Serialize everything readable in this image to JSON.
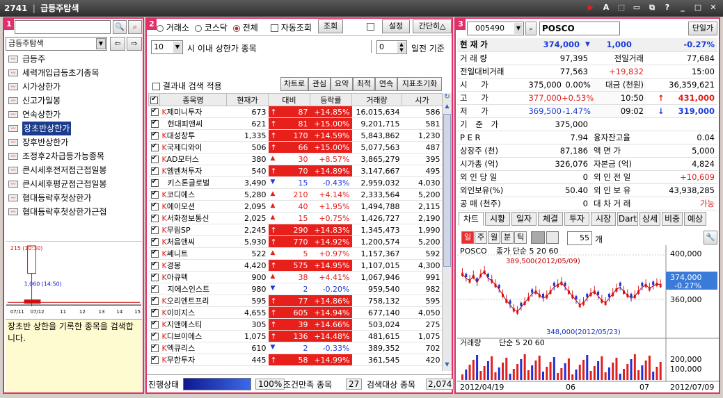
{
  "window": {
    "code": "2741",
    "title": "급등주탐색"
  },
  "left": {
    "panel_no": "1",
    "search_value": "",
    "category": "급등주탐색",
    "items": [
      "급등주",
      "세력개입급등초기종목",
      "시가상한가",
      "신고가일봉",
      "연속상한가",
      "장초반상한가",
      "장후반상한가",
      "조정후2차급등가능종목",
      "큰시세후전저점근접일봉",
      "큰시세후평균점근접일봉",
      "협대등락후첫상한가",
      "협대등락후첫상한가근접"
    ],
    "selected_index": 5,
    "chart": {
      "top_label": "215 (10:30)",
      "low_label": "1,060 (14:50)",
      "x_ticks": [
        "07/11",
        "07/12",
        "11",
        "12",
        "13",
        "14",
        "15"
      ]
    },
    "description": "장초반 상한을 기록한 종목을 검색합니다."
  },
  "mid": {
    "panel_no": "2",
    "market_options": [
      "거래소",
      "코스닥",
      "전체"
    ],
    "market_selected": "전체",
    "auto_label": "자동조회",
    "query_btn": "조회",
    "setting_btn": "설정",
    "simple_btn": "간단히△",
    "minutes": "10",
    "minutes_label": "시 이내 상한가 종목",
    "days": "0",
    "days_label": "일전 기준",
    "within_label": "결과내 검색 적용",
    "action_btns": [
      "차트로",
      "관심",
      "요약",
      "최적",
      "연속",
      "지표초기화"
    ],
    "columns": [
      "종목명",
      "현재가",
      "대비",
      "등락률",
      "거래량",
      "시가"
    ],
    "rows": [
      {
        "k": true,
        "name": "제미니투자",
        "price": "673",
        "dir": "up",
        "diff": "87",
        "rate": "+14.85%",
        "hl": true,
        "vol": "16,015,634",
        "open": "586"
      },
      {
        "k": false,
        "name": "현대피앤씨",
        "price": "621",
        "dir": "up",
        "diff": "81",
        "rate": "+15.00%",
        "hl": true,
        "vol": "9,201,715",
        "open": "581"
      },
      {
        "k": true,
        "name": "대성창투",
        "price": "1,335",
        "dir": "up",
        "diff": "170",
        "rate": "+14.59%",
        "hl": true,
        "vol": "5,843,862",
        "open": "1,230"
      },
      {
        "k": true,
        "name": "국제디와이",
        "price": "506",
        "dir": "up",
        "diff": "66",
        "rate": "+15.00%",
        "hl": true,
        "vol": "5,077,563",
        "open": "487"
      },
      {
        "k": true,
        "name": "AD모터스",
        "price": "380",
        "dir": "tri",
        "diff": "30",
        "rate": "+8.57%",
        "hl": false,
        "vol": "3,865,279",
        "open": "395"
      },
      {
        "k": true,
        "name": "엠벤처투자",
        "price": "540",
        "dir": "up",
        "diff": "70",
        "rate": "+14.89%",
        "hl": true,
        "vol": "3,147,667",
        "open": "495"
      },
      {
        "k": false,
        "name": "키스톤글로벌",
        "price": "3,490",
        "dir": "down",
        "diff": "15",
        "rate": "-0.43%",
        "hl": false,
        "vol": "2,959,032",
        "open": "4,030"
      },
      {
        "k": true,
        "name": "코디에스",
        "price": "5,280",
        "dir": "tri",
        "diff": "210",
        "rate": "+4.14%",
        "hl": false,
        "vol": "2,333,564",
        "open": "5,200"
      },
      {
        "k": true,
        "name": "에이모션",
        "price": "2,095",
        "dir": "tri",
        "diff": "40",
        "rate": "+1.95%",
        "hl": false,
        "vol": "1,494,788",
        "open": "2,115"
      },
      {
        "k": true,
        "name": "서화정보통신",
        "price": "2,025",
        "dir": "tri",
        "diff": "15",
        "rate": "+0.75%",
        "hl": false,
        "vol": "1,426,727",
        "open": "2,190"
      },
      {
        "k": true,
        "name": "무림SP",
        "price": "2,245",
        "dir": "up",
        "diff": "290",
        "rate": "+14.83%",
        "hl": true,
        "vol": "1,345,473",
        "open": "1,990"
      },
      {
        "k": true,
        "name": "처음앤씨",
        "price": "5,930",
        "dir": "up",
        "diff": "770",
        "rate": "+14.92%",
        "hl": true,
        "vol": "1,200,574",
        "open": "5,200"
      },
      {
        "k": true,
        "name": "쎄니트",
        "price": "522",
        "dir": "tri",
        "diff": "5",
        "rate": "+0.97%",
        "hl": false,
        "vol": "1,157,367",
        "open": "592"
      },
      {
        "k": true,
        "name": "경봉",
        "price": "4,420",
        "dir": "up",
        "diff": "575",
        "rate": "+14.95%",
        "hl": true,
        "vol": "1,107,015",
        "open": "4,300"
      },
      {
        "k": true,
        "name": "아큐텍",
        "price": "900",
        "dir": "tri",
        "diff": "38",
        "rate": "+4.41%",
        "hl": false,
        "vol": "1,067,946",
        "open": "991"
      },
      {
        "k": false,
        "name": "지에스인스트",
        "price": "980",
        "dir": "down",
        "diff": "2",
        "rate": "-0.20%",
        "hl": false,
        "vol": "959,540",
        "open": "982"
      },
      {
        "k": true,
        "name": "오리엔트프리",
        "price": "595",
        "dir": "up",
        "diff": "77",
        "rate": "+14.86%",
        "hl": true,
        "vol": "758,132",
        "open": "595"
      },
      {
        "k": true,
        "name": "이미지스",
        "price": "4,655",
        "dir": "up",
        "diff": "605",
        "rate": "+14.94%",
        "hl": true,
        "vol": "677,140",
        "open": "4,050"
      },
      {
        "k": true,
        "name": "지앤에스티",
        "price": "305",
        "dir": "up",
        "diff": "39",
        "rate": "+14.66%",
        "hl": true,
        "vol": "503,024",
        "open": "275"
      },
      {
        "k": true,
        "name": "디브이에스",
        "price": "1,075",
        "dir": "up",
        "diff": "136",
        "rate": "+14.48%",
        "hl": true,
        "vol": "481,615",
        "open": "1,075"
      },
      {
        "k": true,
        "name": "엑큐리스",
        "price": "610",
        "dir": "down",
        "diff": "2",
        "rate": "-0.33%",
        "hl": false,
        "vol": "389,352",
        "open": "702"
      },
      {
        "k": true,
        "name": "무한투자",
        "price": "445",
        "dir": "up",
        "diff": "58",
        "rate": "+14.99%",
        "hl": true,
        "vol": "361,545",
        "open": "420"
      }
    ],
    "status_label": "진행상태",
    "progress": "100%",
    "cond_label": "조건만족 종목",
    "cond_count": "27",
    "target_label": "검색대상 종목",
    "target_count": "2,074"
  },
  "right": {
    "panel_no": "3",
    "code": "005490",
    "name": "POSCO",
    "single_btn": "단일가",
    "cur_label": "현 재 가",
    "cur_price": "374,000",
    "cur_diff": "1,000",
    "cur_rate": "-0.27%",
    "rows": [
      [
        "거 래 량",
        "97,395",
        "전일거래",
        "77,684"
      ],
      [
        "전일대비거래",
        "77,563",
        "+19,832",
        "15:00"
      ]
    ],
    "ohlc": [
      {
        "lbl": "시 가",
        "v": "375,000",
        "p": "0.00%",
        "k": "대금 (천원)",
        "kv": "36,359,621"
      },
      {
        "lbl": "고 가",
        "v": "377,000",
        "p": "+0.53%",
        "k": "10:50",
        "kv": "431,000"
      },
      {
        "lbl": "저 가",
        "v": "369,500",
        "p": "-1.47%",
        "k": "09:02",
        "kv": "319,000"
      }
    ],
    "base_label": "기 준 가",
    "base_value": "375,000",
    "stats": [
      [
        "P E R",
        "7.94",
        "융자잔고율",
        "0.04"
      ],
      [
        "상장주 (천)",
        "87,186",
        "액 면 가",
        "5,000"
      ],
      [
        "시가총 (억)",
        "326,076",
        "자본금 (억)",
        "4,824"
      ],
      [
        "외 인 당 일",
        "0",
        "외 인 전 일",
        "+10,609"
      ],
      [
        "외인보유(%)",
        "50.40",
        "외 인 보 유",
        "43,938,285"
      ],
      [
        "공 매 (천주)",
        "0",
        "대 차 거 래",
        "가능"
      ]
    ],
    "tabs": [
      "차트",
      "시황",
      "일자",
      "체결",
      "투자",
      "시장",
      "Dart",
      "상세",
      "비중",
      "예상"
    ],
    "periods": [
      "일",
      "주",
      "월",
      "분",
      "틱"
    ],
    "period_count": "55",
    "period_unit": "개",
    "chart": {
      "legend": "POSCO",
      "legend2": "종가 단순 5 20 60",
      "high_note": "389,500(2012/05/09)",
      "low_note": "348,000(2012/05/23)",
      "y_ticks": [
        "400,000",
        "360,000"
      ],
      "price_badge": "374,000",
      "rate_badge": "-0.27%",
      "vol_legend": "거래량",
      "vol_legend2": "단순 5 20 60",
      "vol_ticks": [
        "200,000",
        "100,000"
      ],
      "x_ticks": [
        "2012/04/19",
        "06",
        "07",
        "2012/07/09"
      ],
      "zoom": "55"
    }
  }
}
